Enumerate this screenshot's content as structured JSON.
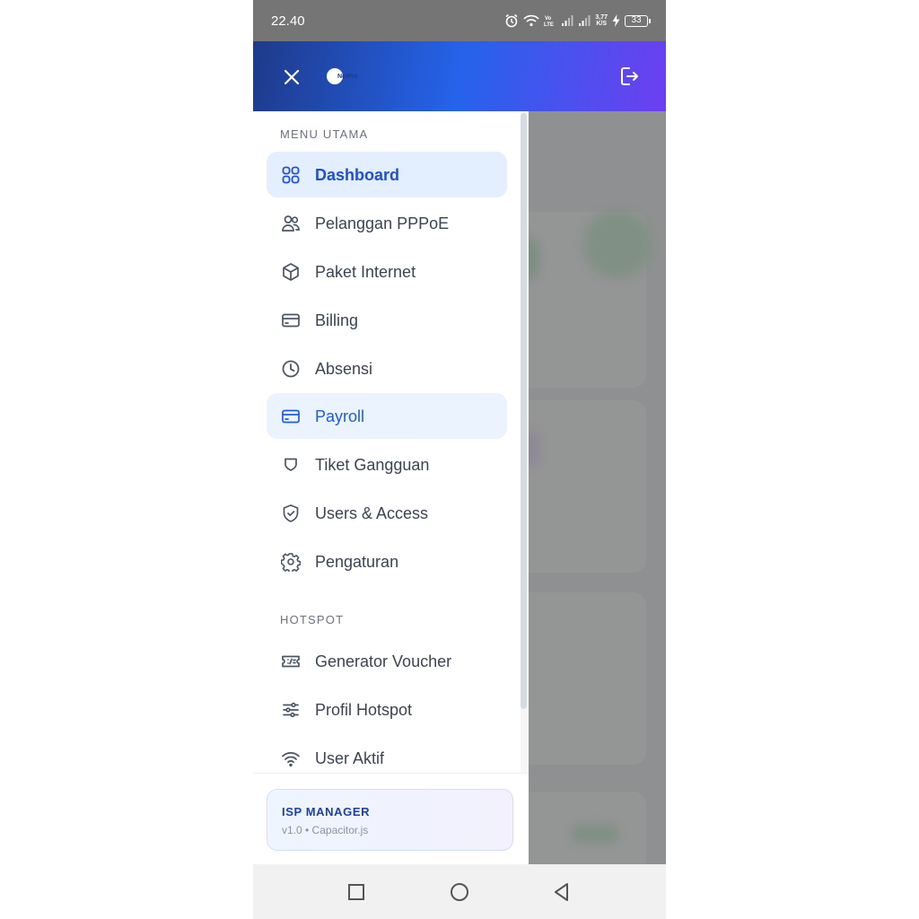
{
  "status_bar": {
    "time": "22.40",
    "net_speed_value": "3,77",
    "net_speed_unit": "K/S",
    "battery": "33"
  },
  "header": {
    "logo_text": "NetPro"
  },
  "menu": {
    "main_section_label": "MENU UTAMA",
    "main_items": [
      {
        "label": "Dashboard",
        "icon": "dashboard-grid-icon"
      },
      {
        "label": "Pelanggan PPPoE",
        "icon": "users-icon"
      },
      {
        "label": "Paket Internet",
        "icon": "box-icon"
      },
      {
        "label": "Billing",
        "icon": "card-icon"
      },
      {
        "label": "Absensi",
        "icon": "clock-icon"
      },
      {
        "label": "Payroll",
        "icon": "card-icon"
      },
      {
        "label": "Tiket Gangguan",
        "icon": "ticket-shield-icon"
      },
      {
        "label": "Users & Access",
        "icon": "shield-check-icon"
      },
      {
        "label": "Pengaturan",
        "icon": "gear-icon"
      }
    ],
    "hotspot_section_label": "HOTSPOT",
    "hotspot_items": [
      {
        "label": "Generator Voucher",
        "icon": "voucher-icon"
      },
      {
        "label": "Profil Hotspot",
        "icon": "sliders-icon"
      },
      {
        "label": "User Aktif",
        "icon": "wifi-icon"
      }
    ]
  },
  "footer": {
    "title": "ISP MANAGER",
    "subtitle": "v1.0 • Capacitor.js"
  },
  "colors": {
    "header_gradient_start": "#1e3a8a",
    "header_gradient_end": "#6d3ff0",
    "active_bg": "#e3eefe",
    "active_text": "#1d4fd8"
  }
}
